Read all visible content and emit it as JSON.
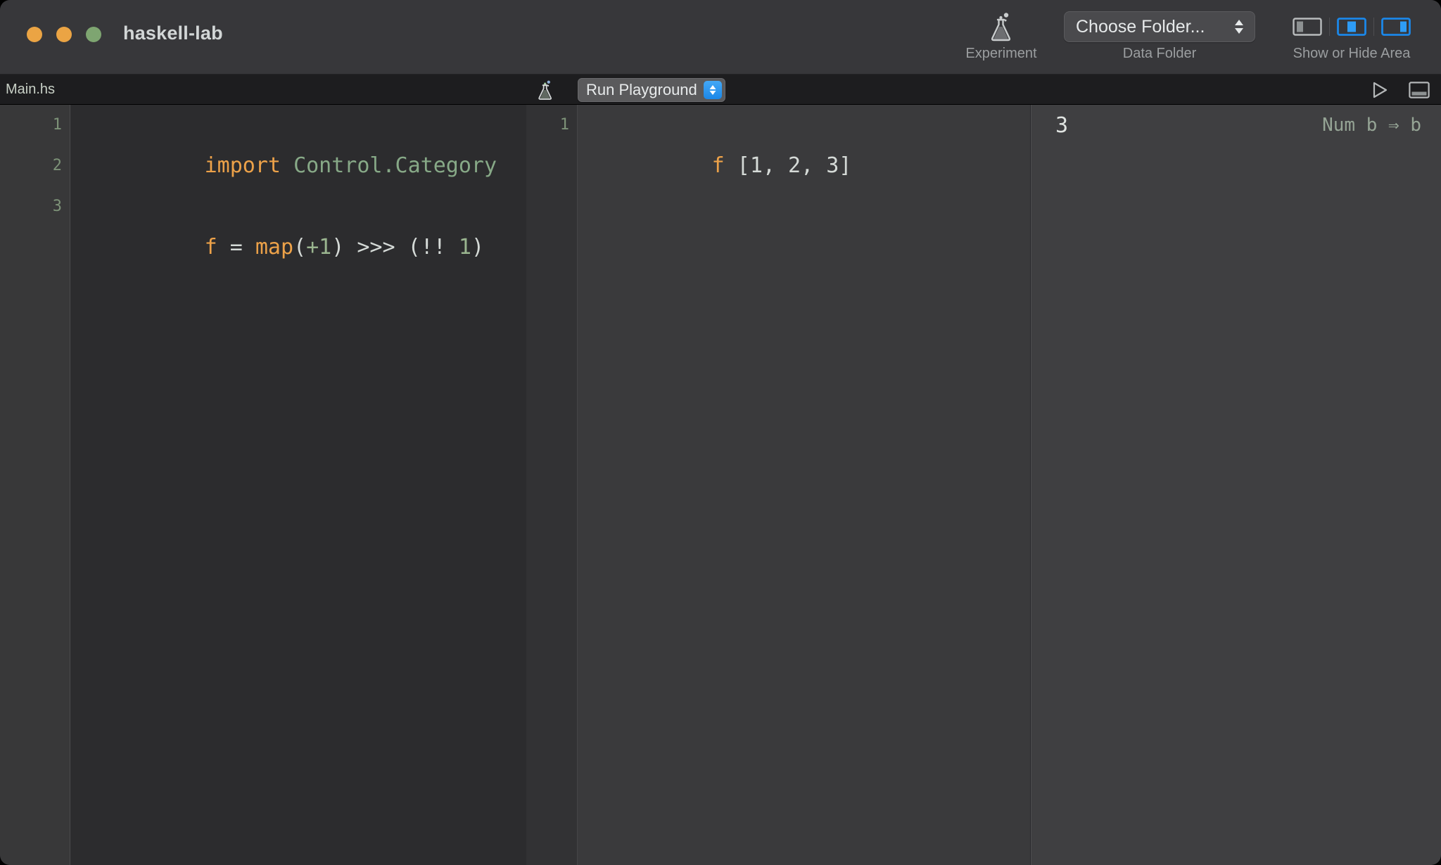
{
  "window": {
    "title": "haskell-lab",
    "traffic_lights": [
      {
        "name": "close",
        "color": "#eba444"
      },
      {
        "name": "minimize",
        "color": "#eba444"
      },
      {
        "name": "zoom",
        "color": "#7ea571"
      }
    ]
  },
  "toolbar": {
    "experiment": {
      "label": "Experiment",
      "icon": "flask-icon"
    },
    "data_folder": {
      "label": "Data Folder",
      "button_value": "Choose Folder...",
      "icon": "stepper-chevron-icon"
    },
    "show_hide_area": {
      "label": "Show or Hide Area",
      "items": [
        {
          "name": "toggle-left-area",
          "active": false
        },
        {
          "name": "toggle-middle-area",
          "active": true
        },
        {
          "name": "toggle-right-area",
          "active": true
        }
      ],
      "accent": "#1b87e8"
    }
  },
  "tabstrip": {
    "filename": "Main.hs",
    "flask_icon": "flask-icon",
    "run_button": {
      "label": "Run Playground",
      "icon": "stepper-chevron-icon"
    },
    "right_buttons": [
      {
        "name": "run-play-icon"
      },
      {
        "name": "toggle-bottom-panel-icon"
      }
    ]
  },
  "editor": {
    "lines": [
      {
        "number": "1",
        "tokens": [
          {
            "text": "import ",
            "type": "kw"
          },
          {
            "text": "Control.Category",
            "type": "mod"
          }
        ]
      },
      {
        "number": "2",
        "tokens": []
      },
      {
        "number": "3",
        "tokens": [
          {
            "text": "f",
            "type": "fn"
          },
          {
            "text": " = ",
            "type": "pun"
          },
          {
            "text": "map",
            "type": "fn"
          },
          {
            "text": "(",
            "type": "pun"
          },
          {
            "text": "+1",
            "type": "num"
          },
          {
            "text": ") >>> (!! ",
            "type": "pun"
          },
          {
            "text": "1",
            "type": "num"
          },
          {
            "text": ")",
            "type": "pun"
          }
        ]
      }
    ]
  },
  "playground": {
    "lines": [
      {
        "number": "1",
        "tokens": [
          {
            "text": "f",
            "type": "fn"
          },
          {
            "text": " [",
            "type": "pun"
          },
          {
            "text": "1",
            "type": "num"
          },
          {
            "text": ", ",
            "type": "pun"
          },
          {
            "text": "2",
            "type": "num"
          },
          {
            "text": ", ",
            "type": "pun"
          },
          {
            "text": "3",
            "type": "num"
          },
          {
            "text": "]",
            "type": "pun"
          }
        ]
      }
    ]
  },
  "results": {
    "rows": [
      {
        "value": "3",
        "type_signature": "Num b ⇒ b"
      }
    ]
  },
  "colors": {
    "keyword": "#eda249",
    "module": "#87a987",
    "number": "#9ab58f",
    "punctuation": "#d5dad7",
    "line_number": "#7d9278",
    "accent_blue": "#1b87e8"
  }
}
